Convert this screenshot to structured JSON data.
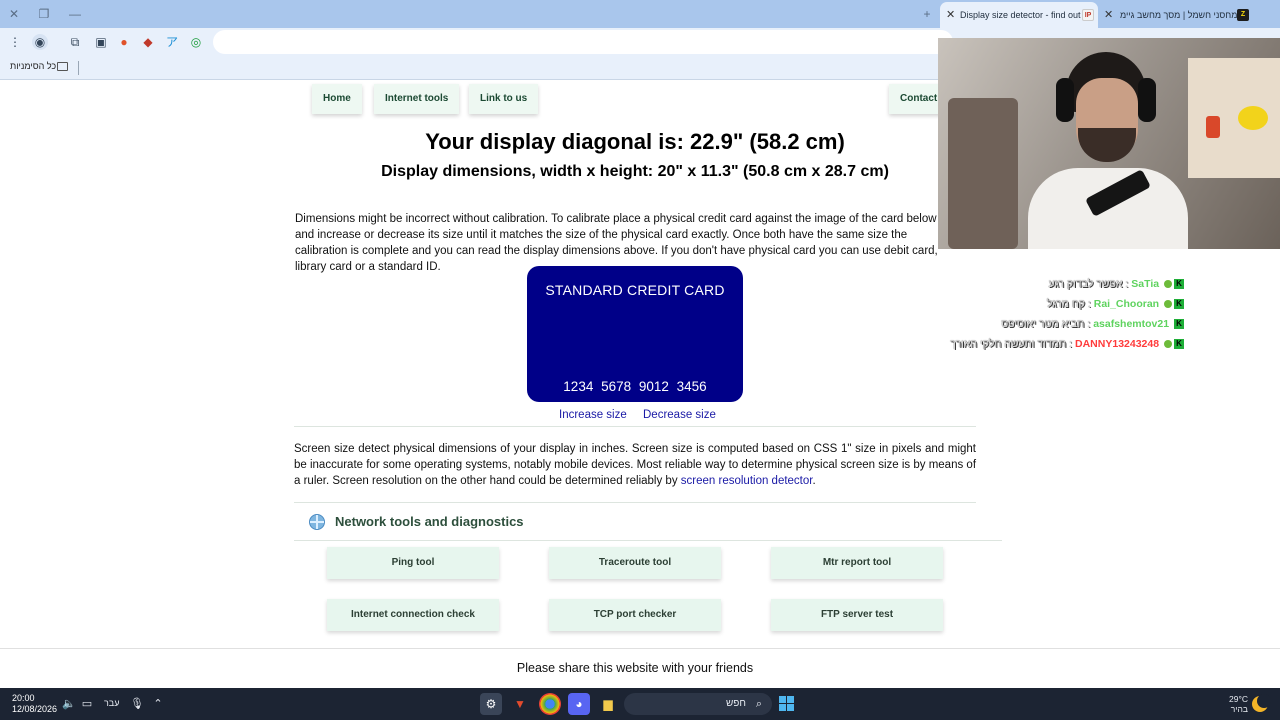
{
  "browser": {
    "tabs": [
      {
        "title": "Display size detector - find out",
        "active": true
      },
      {
        "title": "מחסני חשמל | מסך מחשב גיימ",
        "active": false
      }
    ],
    "bookmarks_label": "כל הסימניות"
  },
  "nav": {
    "items": [
      "Home",
      "Internet tools",
      "Link to us",
      "Contact"
    ]
  },
  "headline": {
    "diagonal": "Your display diagonal is: 22.9\" (58.2 cm)",
    "dimensions": "Display dimensions, width x height: 20\" x 11.3\" (50.8 cm x 28.7 cm)"
  },
  "calibration": {
    "text": "Dimensions might be incorrect without calibration. To calibrate place a physical credit card against the image of the card below and increase or decrease its size until it matches the size of the physical card exactly. Once both have the same size the calibration is complete and you can read the display dimensions above. If you don't have physical card you can use debit card, library card or a standard ID."
  },
  "card": {
    "title": "STANDARD CREDIT CARD",
    "number": "1234 5678 9012 3456",
    "color": "#000088"
  },
  "size_controls": {
    "increase": "Increase size",
    "decrease": "Decrease size"
  },
  "screen_info": {
    "text": "Screen size detect physical dimensions of your display in inches. Screen size is computed based on CSS 1\" size in pixels and might be inaccurate for some operating systems, notably mobile devices. Most reliable way to determine physical screen size is by means of a ruler. Screen resolution on the other hand could be determined reliably by ",
    "link": "screen resolution detector",
    "end": "."
  },
  "network": {
    "title": "Network tools and diagnostics",
    "tools": [
      "Ping tool",
      "Traceroute tool",
      "Mtr report tool",
      "Internet connection check",
      "TCP port checker",
      "FTP server test"
    ]
  },
  "share": {
    "text": "Please share this website with your friends"
  },
  "chat": {
    "messages": [
      {
        "user": "SaTia",
        "text": "אפשר לבדוק רגע",
        "color": "#5fd35f"
      },
      {
        "user": "Rai_Chooran",
        "text": "קח מרגל",
        "color": "#5fd35f"
      },
      {
        "user": "asafshemtov21",
        "text": "תביא מטר יאוסיפס",
        "color": "#5fd35f"
      },
      {
        "user": "DANNY13243248",
        "text": "תמדוד ותעשה חלקי האורך",
        "color": "#ff3b3b"
      }
    ]
  },
  "taskbar": {
    "time": "20:00",
    "date": "12/08/2026",
    "language": "עבר",
    "search": "חפש",
    "temperature": "29°C",
    "weather": "בהיר"
  }
}
